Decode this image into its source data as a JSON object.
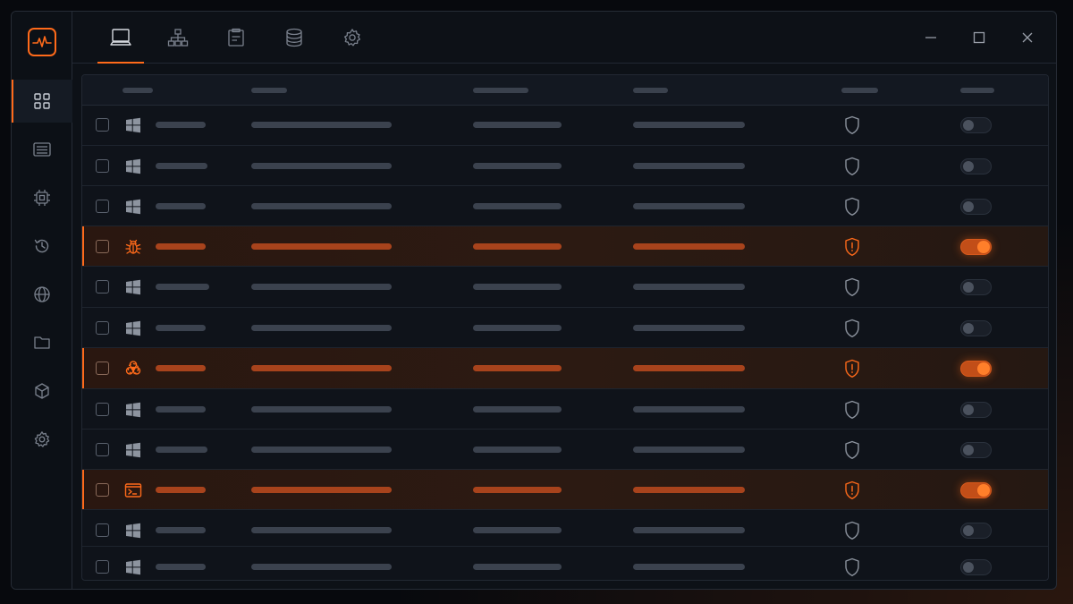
{
  "colors": {
    "accent": "#ff6a1a",
    "background": "#0d1117",
    "muted_bar": "#3b424e",
    "threat_bar": "#a8431c"
  },
  "sidebar": {
    "logo_icon": "activity-pulse-icon",
    "items": [
      {
        "icon": "dashboard-grid-icon",
        "active": true
      },
      {
        "icon": "list-icon",
        "active": false
      },
      {
        "icon": "cpu-chip-icon",
        "active": false
      },
      {
        "icon": "history-clock-icon",
        "active": false
      },
      {
        "icon": "globe-icon",
        "active": false
      },
      {
        "icon": "folder-icon",
        "active": false
      },
      {
        "icon": "package-cube-icon",
        "active": false
      },
      {
        "icon": "gear-icon",
        "active": false
      }
    ]
  },
  "tabs": [
    {
      "icon": "monitor-icon",
      "active": true
    },
    {
      "icon": "network-hierarchy-icon",
      "active": false
    },
    {
      "icon": "clipboard-report-icon",
      "active": false
    },
    {
      "icon": "database-icon",
      "active": false
    },
    {
      "icon": "settings-gear-icon",
      "active": false
    }
  ],
  "window_controls": [
    "minimize-icon",
    "maximize-icon",
    "close-icon"
  ],
  "table": {
    "rows": [
      {
        "type": "windows",
        "icon": "windows-icon",
        "threat": false,
        "enabled": false
      },
      {
        "type": "windows",
        "icon": "windows-icon",
        "threat": false,
        "enabled": false
      },
      {
        "type": "windows",
        "icon": "windows-icon",
        "threat": false,
        "enabled": false
      },
      {
        "type": "bug",
        "icon": "bug-icon",
        "threat": true,
        "enabled": true
      },
      {
        "type": "windows",
        "icon": "windows-icon",
        "threat": false,
        "enabled": false
      },
      {
        "type": "windows",
        "icon": "windows-icon",
        "threat": false,
        "enabled": false
      },
      {
        "type": "biohazard",
        "icon": "biohazard-icon",
        "threat": true,
        "enabled": true
      },
      {
        "type": "windows",
        "icon": "windows-icon",
        "threat": false,
        "enabled": false
      },
      {
        "type": "windows",
        "icon": "windows-icon",
        "threat": false,
        "enabled": false
      },
      {
        "type": "terminal",
        "icon": "terminal-icon",
        "threat": true,
        "enabled": true
      },
      {
        "type": "windows",
        "icon": "windows-icon",
        "threat": false,
        "enabled": false
      },
      {
        "type": "windows",
        "icon": "windows-icon",
        "threat": false,
        "enabled": false
      }
    ]
  }
}
